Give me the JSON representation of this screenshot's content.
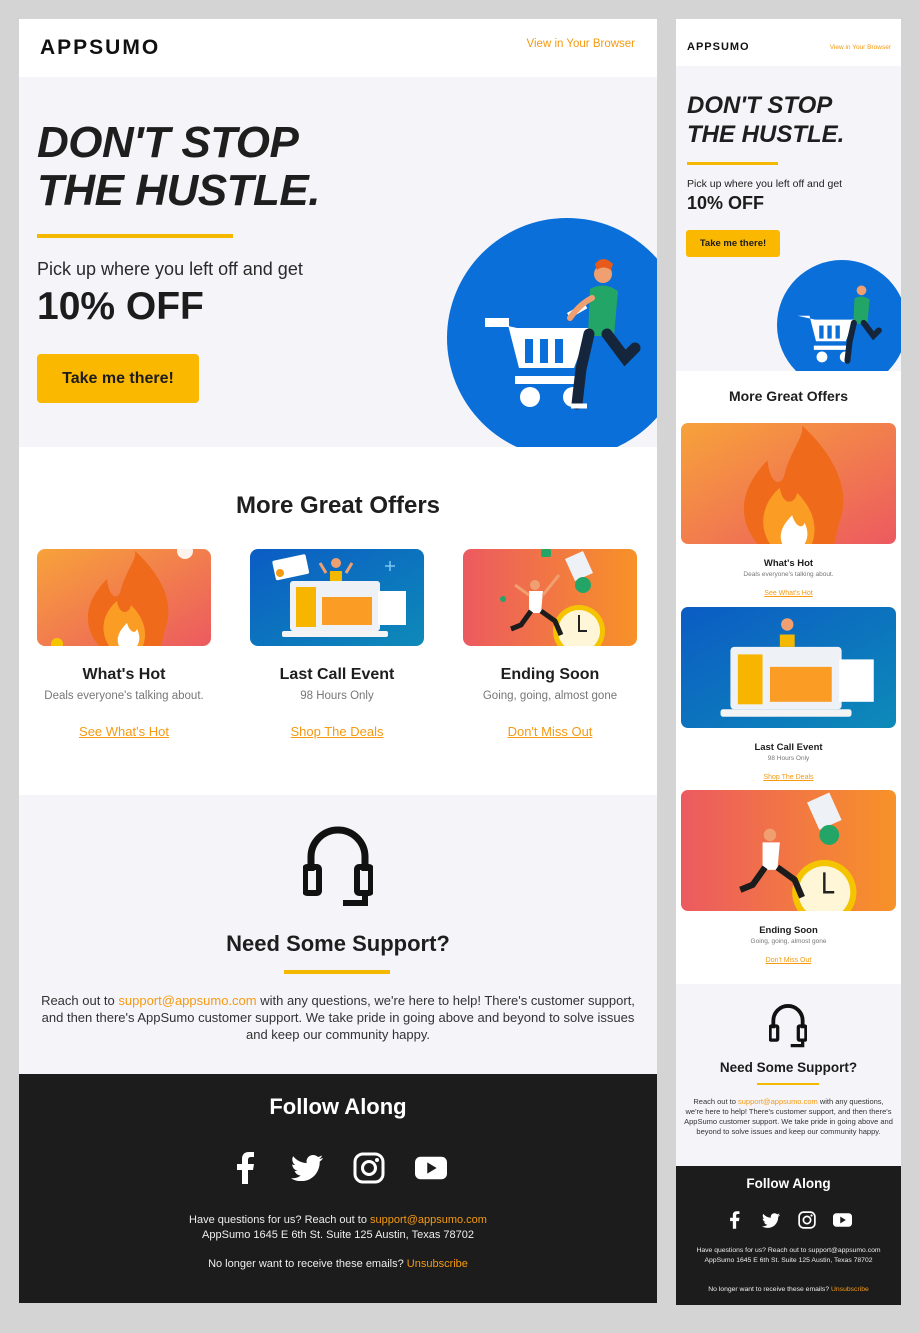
{
  "brand": {
    "logo": "APPSUMO",
    "view_in_browser": "View in Your Browser"
  },
  "hero": {
    "headline_line1": "DON'T STOP",
    "headline_line2": "THE HUSTLE.",
    "pick_up": "Pick up where you left off and get",
    "discount": "10% OFF",
    "cta": "Take me there!",
    "illustration": "shopping-cart-runner-illustration"
  },
  "offers": {
    "title": "More Great Offers",
    "cards": [
      {
        "title": "What's Hot",
        "subtitle": "Deals everyone's talking about.",
        "link": "See What's Hot",
        "image": "fire-illustration"
      },
      {
        "title": "Last Call Event",
        "subtitle": "98 Hours Only",
        "link": "Shop The Deals",
        "image": "laptop-deals-illustration"
      },
      {
        "title": "Ending Soon",
        "subtitle": "Going, going, almost gone",
        "link": "Don't Miss Out",
        "image": "clock-runner-illustration"
      }
    ]
  },
  "support": {
    "icon": "headset-icon",
    "title": "Need Some Support?",
    "text_before": "Reach out to ",
    "email": "support@appsumo.com",
    "text_after": " with any questions, we're here to help! There's customer support, and then there's AppSumo customer support. We take pride in going above and beyond to solve issues and keep our community happy."
  },
  "footer": {
    "follow": "Follow Along",
    "social": [
      "facebook-icon",
      "twitter-icon",
      "instagram-icon",
      "youtube-icon"
    ],
    "questions": "Have questions for us? Reach out to ",
    "email": "support@appsumo.com",
    "address": "AppSumo 1645 E 6th St. Suite 125 Austin, Texas 78702",
    "unsub_text": "No longer want to receive these emails? ",
    "unsub_link": "Unsubscribe"
  },
  "colors": {
    "accent": "#f59a12",
    "yellow": "#fbb800",
    "blue": "#0a6fd8",
    "dark": "#1c1c1c",
    "light_bg": "#f4f4f9"
  }
}
